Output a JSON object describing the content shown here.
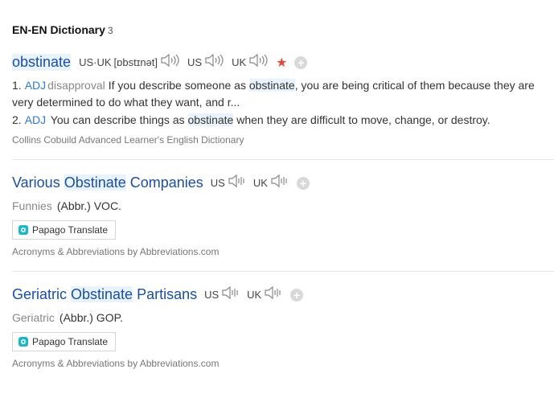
{
  "header": {
    "title": "EN-EN Dictionary",
    "count": "3"
  },
  "entry1": {
    "word": "obstinate",
    "pron_label": "US·UK",
    "phonetic": "[ɒbstɪnət]",
    "us": "US",
    "uk": "UK",
    "defs": [
      {
        "num": "1.",
        "pos": "ADJ",
        "label": "disapproval",
        "pre": "If you describe someone as ",
        "hl": "obstinate",
        "post": ", you are being critical of them because they are very determined to do what they want, and r..."
      },
      {
        "num": "2.",
        "pos": "ADJ",
        "label": "",
        "pre": "You can describe things as ",
        "hl": "obstinate",
        "post": " when they are difficult to move, change, or destroy."
      }
    ],
    "source": "Collins Cobuild Advanced Learner's English Dictionary"
  },
  "entry2": {
    "word_pre": "Various ",
    "word_hl": "Obstinate",
    "word_post": " Companies",
    "us": "US",
    "uk": "UK",
    "label": "Funnies",
    "abbr": "(Abbr.) VOC.",
    "button": "Papago Translate",
    "source": "Acronyms & Abbreviations by Abbreviations.com"
  },
  "entry3": {
    "word_pre": "Geriatric ",
    "word_hl": "Obstinate",
    "word_post": " Partisans",
    "us": "US",
    "uk": "UK",
    "label": "Geriatric",
    "abbr": "(Abbr.) GOP.",
    "button": "Papago Translate",
    "source": "Acronyms & Abbreviations by Abbreviations.com"
  }
}
